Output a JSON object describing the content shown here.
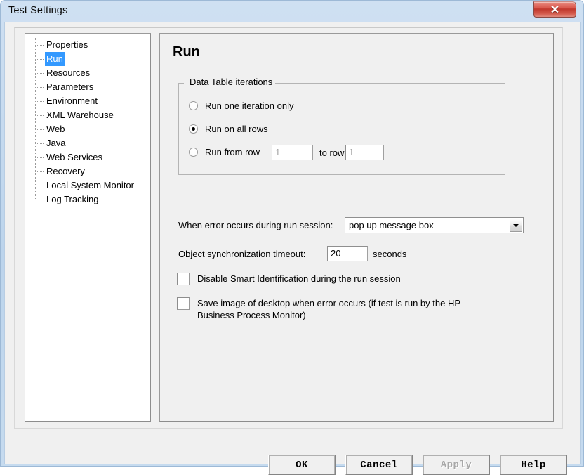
{
  "window": {
    "title": "Test Settings",
    "close_icon": "close-icon",
    "close_glyph": "✕"
  },
  "sidebar": {
    "items": [
      {
        "label": "Properties",
        "selected": false
      },
      {
        "label": "Run",
        "selected": true
      },
      {
        "label": "Resources",
        "selected": false
      },
      {
        "label": "Parameters",
        "selected": false
      },
      {
        "label": "Environment",
        "selected": false
      },
      {
        "label": "XML Warehouse",
        "selected": false
      },
      {
        "label": "Web",
        "selected": false
      },
      {
        "label": "Java",
        "selected": false
      },
      {
        "label": "Web Services",
        "selected": false
      },
      {
        "label": "Recovery",
        "selected": false
      },
      {
        "label": "Local System Monitor",
        "selected": false
      },
      {
        "label": "Log Tracking",
        "selected": false
      }
    ]
  },
  "main": {
    "page_title": "Run",
    "groupbox": {
      "title": "Data Table iterations",
      "radios": [
        {
          "label": "Run one iteration only",
          "checked": false
        },
        {
          "label": "Run on all rows",
          "checked": true
        },
        {
          "label": "Run from row",
          "checked": false
        }
      ],
      "from_row_value": "1",
      "to_row_label": "to row",
      "to_row_value": "1"
    },
    "error_label": "When error occurs during run session:",
    "error_selected": "pop up message box",
    "combo_arrow_icon": "chevron-down-icon",
    "timeout_label": "Object synchronization timeout:",
    "timeout_value": "20",
    "timeout_units": "seconds",
    "checkboxes": [
      {
        "label": "Disable Smart Identification during the run session",
        "checked": false
      },
      {
        "label": "Save image of desktop when error occurs (if test is run by the HP Business Process Monitor)",
        "checked": false
      }
    ]
  },
  "buttons": [
    {
      "label": "OK",
      "disabled": false
    },
    {
      "label": "Cancel",
      "disabled": false
    },
    {
      "label": "Apply",
      "disabled": true
    },
    {
      "label": "Help",
      "disabled": false
    }
  ],
  "colors": {
    "selection": "#3399ff",
    "titlebar": "#bcd4ec",
    "close": "#c0372c"
  }
}
